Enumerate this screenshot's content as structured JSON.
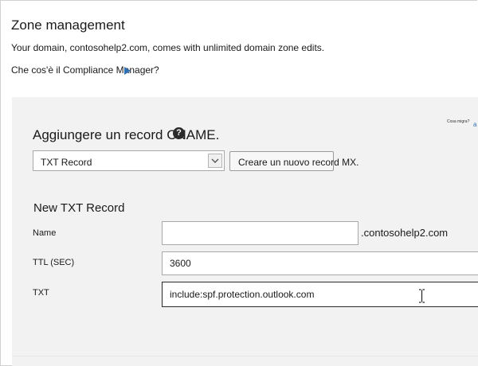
{
  "header": {
    "title": "Zone management",
    "description": "Your domain, contosohelp2.com, comes with unlimited domain zone edits.",
    "help_link": "Che cos'è il Compliance Manager?"
  },
  "add_record": {
    "heading": "Aggiungere un record CNAME.",
    "help_icon_glyph": "?",
    "tiny_note": "Cosa migra?",
    "tiny_link": "a",
    "record_type_value": "TXT Record",
    "create_button_label": "Creare un nuovo record MX."
  },
  "form": {
    "heading": "New TXT Record",
    "name_label": "Name",
    "name_value": "",
    "domain_suffix": ".contosohelp2.com",
    "ttl_label": "TTL (SEC)",
    "ttl_value": "3600",
    "txt_label": "TXT",
    "txt_value": "include:spf.protection.outlook.com"
  },
  "colors": {
    "panel_background": "#f2f2f2",
    "link_arrow": "#2f6fb3"
  },
  "icons": [
    "pointer-arrow-icon",
    "help-circle-icon",
    "chevron-down-icon",
    "text-cursor-icon"
  ]
}
